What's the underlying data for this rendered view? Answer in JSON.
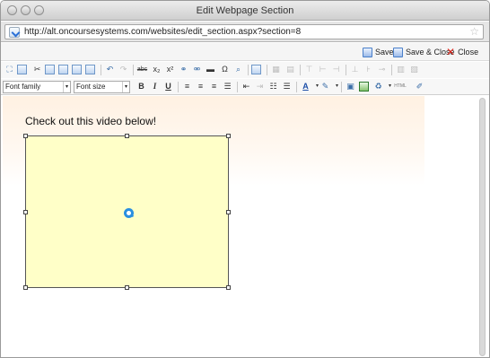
{
  "window": {
    "title": "Edit Webpage Section"
  },
  "address_bar": {
    "url": "http://alt.oncoursesystems.com/websites/edit_section.aspx?section=8"
  },
  "actions": {
    "save": "Save",
    "save_close": "Save & Close",
    "close": "Close"
  },
  "format_toolbar": {
    "font_family": "Font family",
    "font_size": "Font size",
    "bold": "B",
    "italic": "I",
    "underline": "U",
    "text_color": "A",
    "html_label": "HTML"
  },
  "icons": {
    "close_x": "✕",
    "star": "☆",
    "undo": "↶",
    "redo": "↷",
    "strike": "abc",
    "sub": "x₂",
    "sup": "x²",
    "omega": "Ω",
    "dropdown": "▾"
  },
  "content": {
    "intro_text": "Check out this video below!"
  },
  "colors": {
    "video_placeholder_bg": "#ffffc8",
    "accent_blue": "#2a8fe0",
    "close_red": "#d9261c"
  }
}
